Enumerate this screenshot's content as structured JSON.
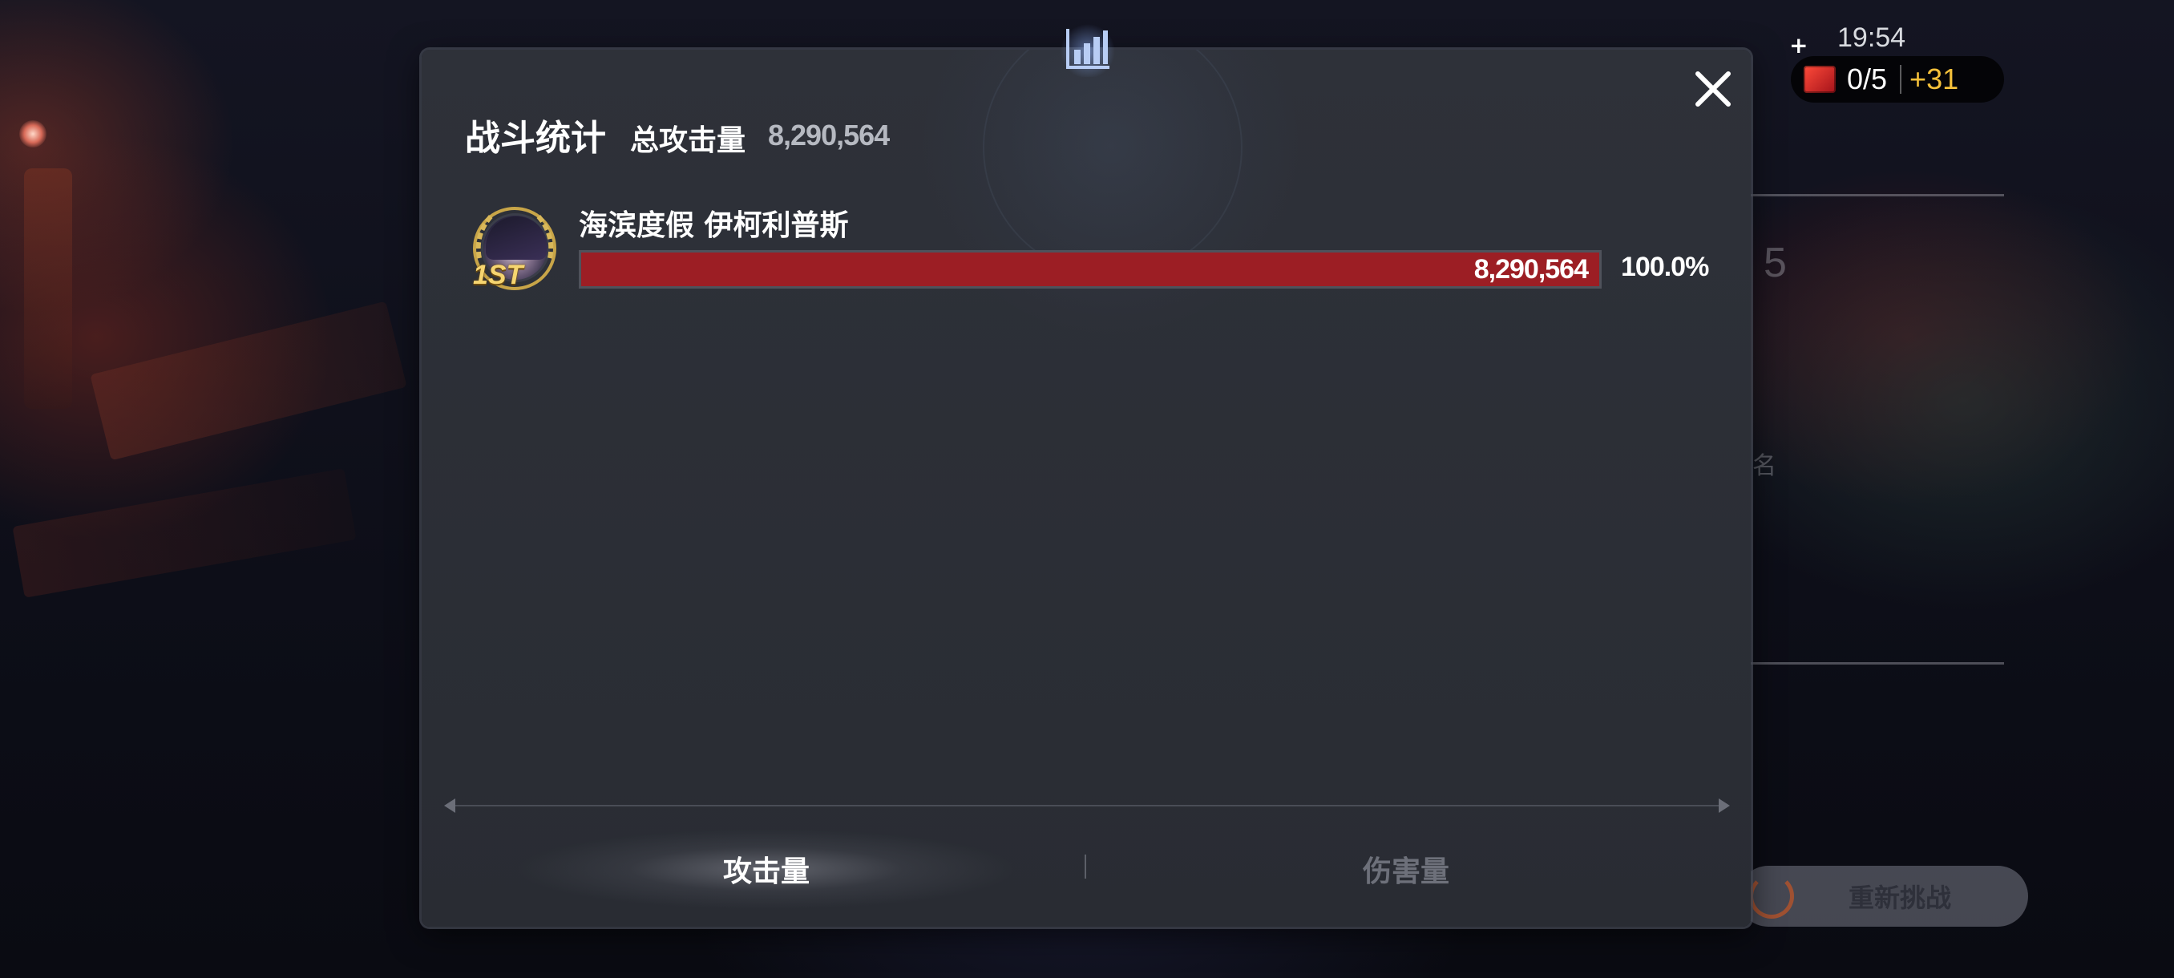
{
  "status": {
    "time": "19:54",
    "plus": "+",
    "stamina": "0/5",
    "stamina_bonus": "+31"
  },
  "background": {
    "retry_label": "重新挑战",
    "fragment_number": "5",
    "fragment_text": "名"
  },
  "dialog": {
    "title": "战斗统计",
    "total_label": "总攻击量",
    "total_value": "8,290,564",
    "entries": [
      {
        "rank": "1ST",
        "name": "海滨度假 伊柯利普斯",
        "value": "8,290,564",
        "share": 1.0,
        "percent_text": "100.0%"
      }
    ],
    "tabs": [
      {
        "label": "攻击量",
        "active": true
      },
      {
        "label": "伤害量",
        "active": false
      }
    ]
  },
  "icons": {
    "chart": "bar-chart-icon",
    "close": "close-icon"
  },
  "colors": {
    "bar_fill": "#9c1e24",
    "stamina_bonus": "#f4c03a",
    "rank_gold": "#f6d570"
  }
}
